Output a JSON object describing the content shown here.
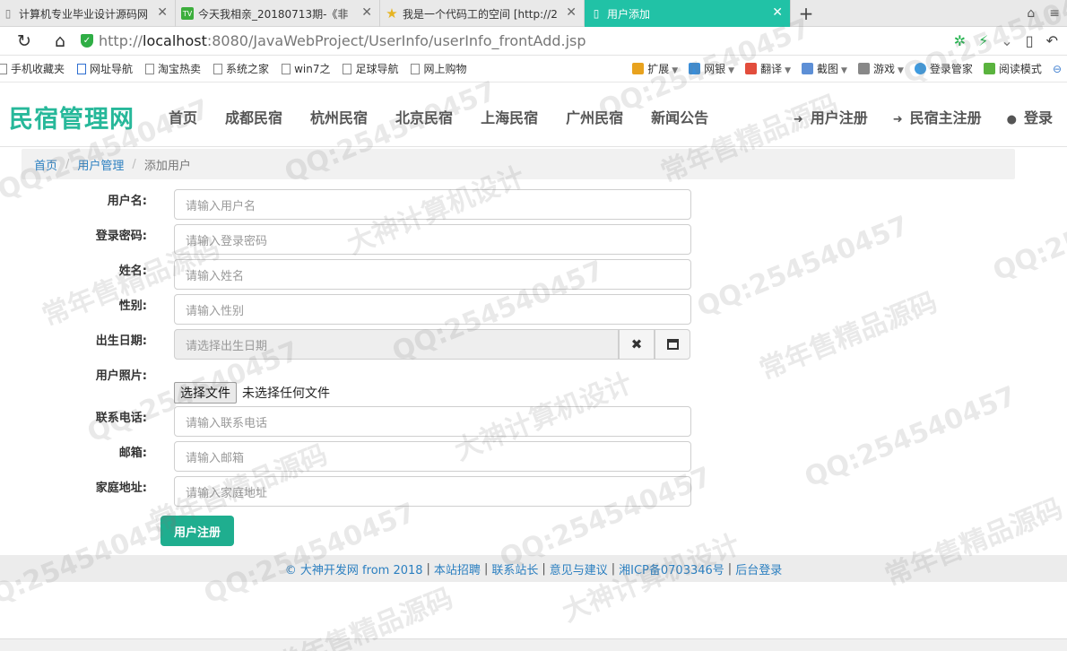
{
  "browser": {
    "tabs": [
      {
        "label": "计算机专业毕业设计源码网",
        "icon": "page-icon",
        "active": false
      },
      {
        "label": "今天我相亲_20180713期-《非",
        "icon": "video-site-icon",
        "active": false
      },
      {
        "label": "我是一个代码工的空间 [http://2",
        "icon": "star-icon",
        "active": false
      },
      {
        "label": "用户添加",
        "icon": "page-icon",
        "active": true
      }
    ],
    "url_scheme": "http://",
    "url_host": "localhost",
    "url_rest": ":8080/JavaWebProject/UserInfo/userInfo_frontAdd.jsp",
    "bookmarks": [
      "手机收藏夹",
      "网址导航",
      "淘宝热卖",
      "系统之家",
      "win7之",
      "足球导航",
      "网上购物"
    ],
    "toolbar_right": [
      "扩展",
      "网银",
      "翻译",
      "截图",
      "游戏",
      "登录管家",
      "阅读模式"
    ]
  },
  "site": {
    "logo": "民宿管理网",
    "nav": [
      "首页",
      "成都民宿",
      "杭州民宿",
      "北京民宿",
      "上海民宿",
      "广州民宿",
      "新闻公告"
    ],
    "user_nav": [
      "用户注册",
      "民宿主注册",
      "登录"
    ]
  },
  "breadcrumb": {
    "home": "首页",
    "section": "用户管理",
    "current": "添加用户"
  },
  "form": {
    "username_label": "用户名:",
    "username_placeholder": "请输入用户名",
    "password_label": "登录密码:",
    "password_placeholder": "请输入登录密码",
    "name_label": "姓名:",
    "name_placeholder": "请输入姓名",
    "gender_label": "性别:",
    "gender_placeholder": "请输入性别",
    "birth_label": "出生日期:",
    "birth_placeholder": "请选择出生日期",
    "photo_label": "用户照片:",
    "photo_button": "选择文件",
    "photo_status": "未选择任何文件",
    "phone_label": "联系电话:",
    "phone_placeholder": "请输入联系电话",
    "email_label": "邮箱:",
    "email_placeholder": "请输入邮箱",
    "address_label": "家庭地址:",
    "address_placeholder": "请输入家庭地址",
    "submit_label": "用户注册"
  },
  "footer": {
    "copyright": "© 大神开发网 from 2018",
    "links": [
      "本站招聘",
      "联系站长",
      "意见与建议",
      "湘ICP备0703346号",
      "后台登录"
    ]
  },
  "watermark": {
    "text_qq": "QQ:254540457",
    "text_design": "大神计算机设计",
    "text_sale": "常年售精品源码"
  },
  "colors": {
    "accent": "#21c2a6",
    "logo": "#27b89a",
    "button": "#1fae8f",
    "link": "#2b7fc0"
  }
}
